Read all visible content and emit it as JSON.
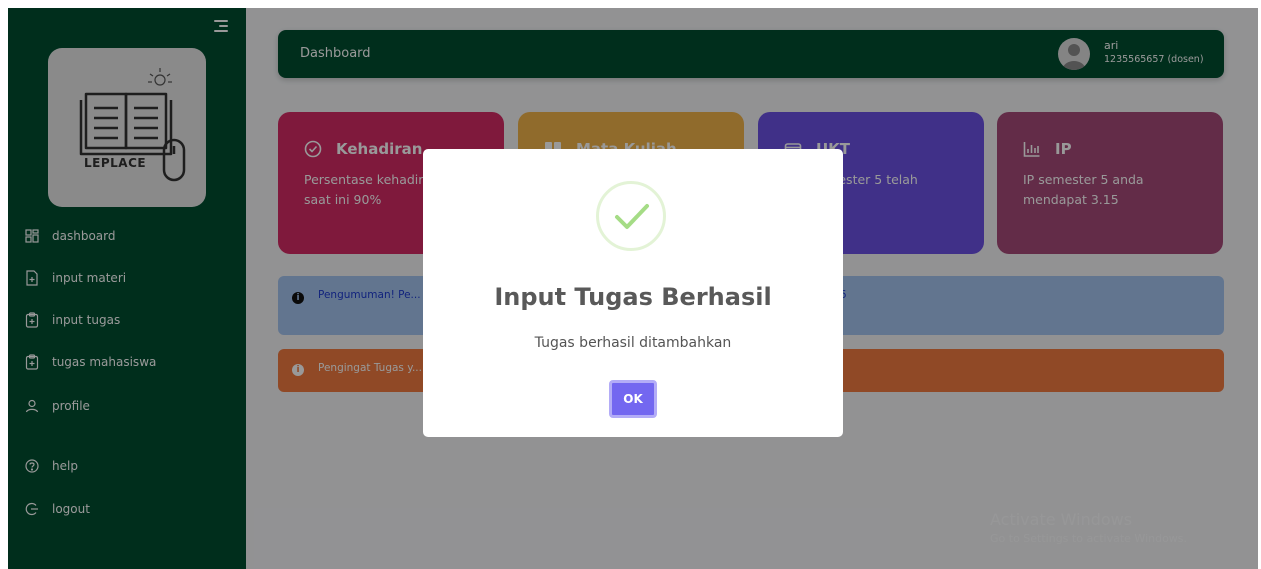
{
  "sidebar": {
    "logo_text": "LEPLACE",
    "items": [
      {
        "label": "dashboard",
        "icon": "grid-icon"
      },
      {
        "label": "input materi",
        "icon": "file-plus-icon"
      },
      {
        "label": "input tugas",
        "icon": "clipboard-plus-icon"
      },
      {
        "label": "tugas mahasiswa",
        "icon": "clipboard-plus-icon"
      },
      {
        "label": "profile",
        "icon": "user-icon"
      },
      {
        "label": "help",
        "icon": "help-circle-icon"
      },
      {
        "label": "logout",
        "icon": "logout-icon"
      }
    ]
  },
  "header": {
    "title": "Dashboard",
    "user_name": "ari",
    "user_id": "1235565657 (dosen)"
  },
  "cards": [
    {
      "title": "Kehadiran",
      "text": "Persentase kehadiran anda saat ini 90%",
      "color": "#d42a65",
      "icon": "check-circle-icon"
    },
    {
      "title": "Mata Kuliah",
      "text": "",
      "color": "#f1b34a",
      "icon": "book-icon"
    },
    {
      "title": "UKT",
      "text": "UKT semester 5 telah",
      "color": "#6b50e3",
      "icon": "wallet-icon"
    },
    {
      "title": "IP",
      "text": "IP semester 5 anda mendapat 3.15",
      "color": "#a54a78",
      "icon": "bar-chart-icon"
    }
  ],
  "alerts": [
    {
      "text": "Pengumuman! Pe... erkendala untuk enroll mata kuliah silahkan hubungi PUTI di nomor +62 123456",
      "color": "#a4c3ef"
    },
    {
      "text": "Pengingat Tugas y... lai.",
      "color": "#f07a40"
    }
  ],
  "watermark": {
    "line1": "Activate Windows",
    "line2": "Go to Settings to activate Windows."
  },
  "modal": {
    "title": "Input Tugas Berhasil",
    "text": "Tugas berhasil ditambahkan",
    "ok_label": "OK",
    "icon": "success-check-icon",
    "accent": "#7367f0"
  }
}
